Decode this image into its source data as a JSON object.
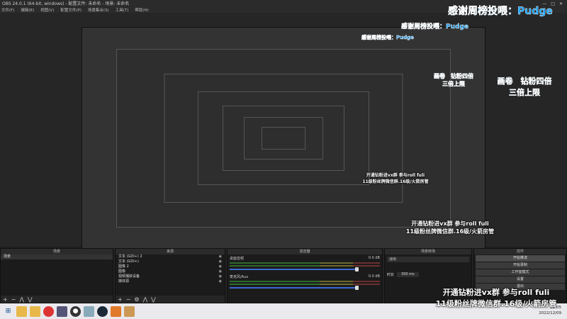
{
  "window": {
    "title": "OBS 24.0.1 (64-bit, windows) - 配置文件: 未命名 - 场景: 未命名"
  },
  "menu": [
    "文件(F)",
    "编辑(E)",
    "视图(V)",
    "配置文件(P)",
    "场景集合(S)",
    "工具(T)",
    "帮助(H)"
  ],
  "overlay": {
    "thanks": "感谢周榜投喂：Pudge",
    "scroll_line1": "画卷　钻粉四倍",
    "scroll_line2": "三倍上限",
    "promo_line1": "开通钻粉进vx群 参与roll fuli",
    "promo_line2": "11级粉丝牌微信群.16级/火箭房管"
  },
  "docks": {
    "scenes": {
      "title": "场景",
      "items": [
        "场景"
      ]
    },
    "sources": {
      "title": "来源",
      "items": [
        "文本 (GDI+) 2",
        "文本 (GDI+)",
        "图像 2",
        "图像",
        "视频捕获设备",
        "媒体源"
      ]
    },
    "mixer": {
      "title": "混音器",
      "tracks": [
        {
          "name": "桌面音频",
          "db": "0.0 dB",
          "level": 0.85
        },
        {
          "name": "麦克风/Aux",
          "db": "0.0 dB",
          "level": 0.85
        }
      ]
    },
    "transitions": {
      "title": "场景转场",
      "type": "淡出",
      "duration_label": "时长",
      "duration": "300 ms"
    },
    "controls": {
      "title": "控件",
      "buttons": [
        "开始推流",
        "开始录制",
        "工作室模式",
        "设置",
        "退出"
      ]
    }
  },
  "taskbar": {
    "time": "22:05",
    "date": "2022/12/09"
  },
  "colors": {
    "accent_text": "#0aa0ff",
    "fader": "#3a6ad0",
    "background": "#1e1e1e"
  }
}
